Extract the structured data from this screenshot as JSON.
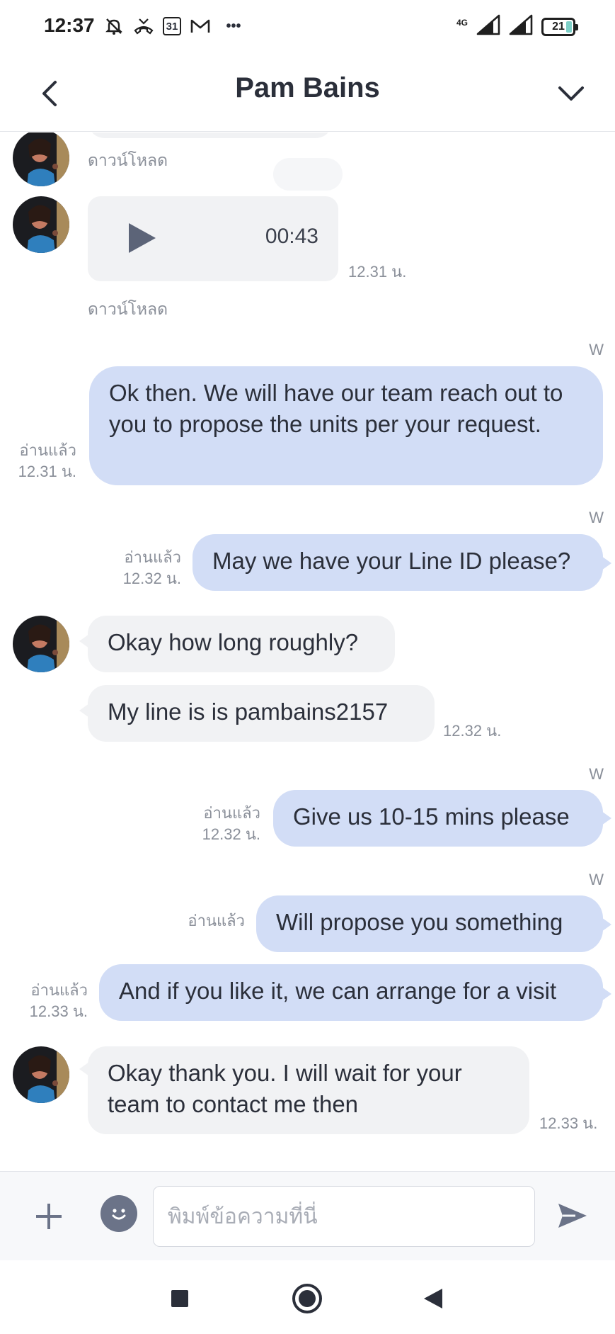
{
  "status_bar": {
    "time": "12:37",
    "calendar_day": "31",
    "more": "•••",
    "network": "4G",
    "battery": "21",
    "icons": [
      "mute-icon",
      "missed-call-icon",
      "calendar-icon",
      "gmail-icon",
      "signal-icon",
      "battery-icon"
    ]
  },
  "header": {
    "title": "Pam Bains"
  },
  "messages": {
    "top_download": "ดาวน์โหลด",
    "voice": {
      "duration": "00:43",
      "time": "12.31 น.",
      "download": "ดาวน์โหลด"
    },
    "m1": {
      "w": "W",
      "read": "อ่านแล้ว",
      "time": "12.31 น.",
      "text": "Ok then. We will have our team reach out to you to propose the units per your request."
    },
    "m2": {
      "w": "W",
      "read": "อ่านแล้ว",
      "time": "12.32 น.",
      "text": "May we have your Line ID please?"
    },
    "m3": {
      "text": "Okay how long roughly?"
    },
    "m4": {
      "text": "My line is is pambains2157",
      "time": "12.32 น."
    },
    "m5": {
      "w": "W",
      "read": "อ่านแล้ว",
      "time": "12.32 น.",
      "text": "Give us 10-15 mins please"
    },
    "m6": {
      "w": "W",
      "read": "อ่านแล้ว",
      "text": "Will propose you something"
    },
    "m7": {
      "read": "อ่านแล้ว",
      "time": "12.33 น.",
      "text": "And if you like it, we can arrange for a visit"
    },
    "m8": {
      "text": "Okay thank you. I will wait for your team to contact me then",
      "time": "12.33 น."
    }
  },
  "input": {
    "placeholder": "พิมพ์ข้อความที่นี่"
  },
  "colors": {
    "incoming_bubble": "#f1f2f4",
    "outgoing_bubble": "#d2ddf6",
    "icon": "#6b7388"
  }
}
